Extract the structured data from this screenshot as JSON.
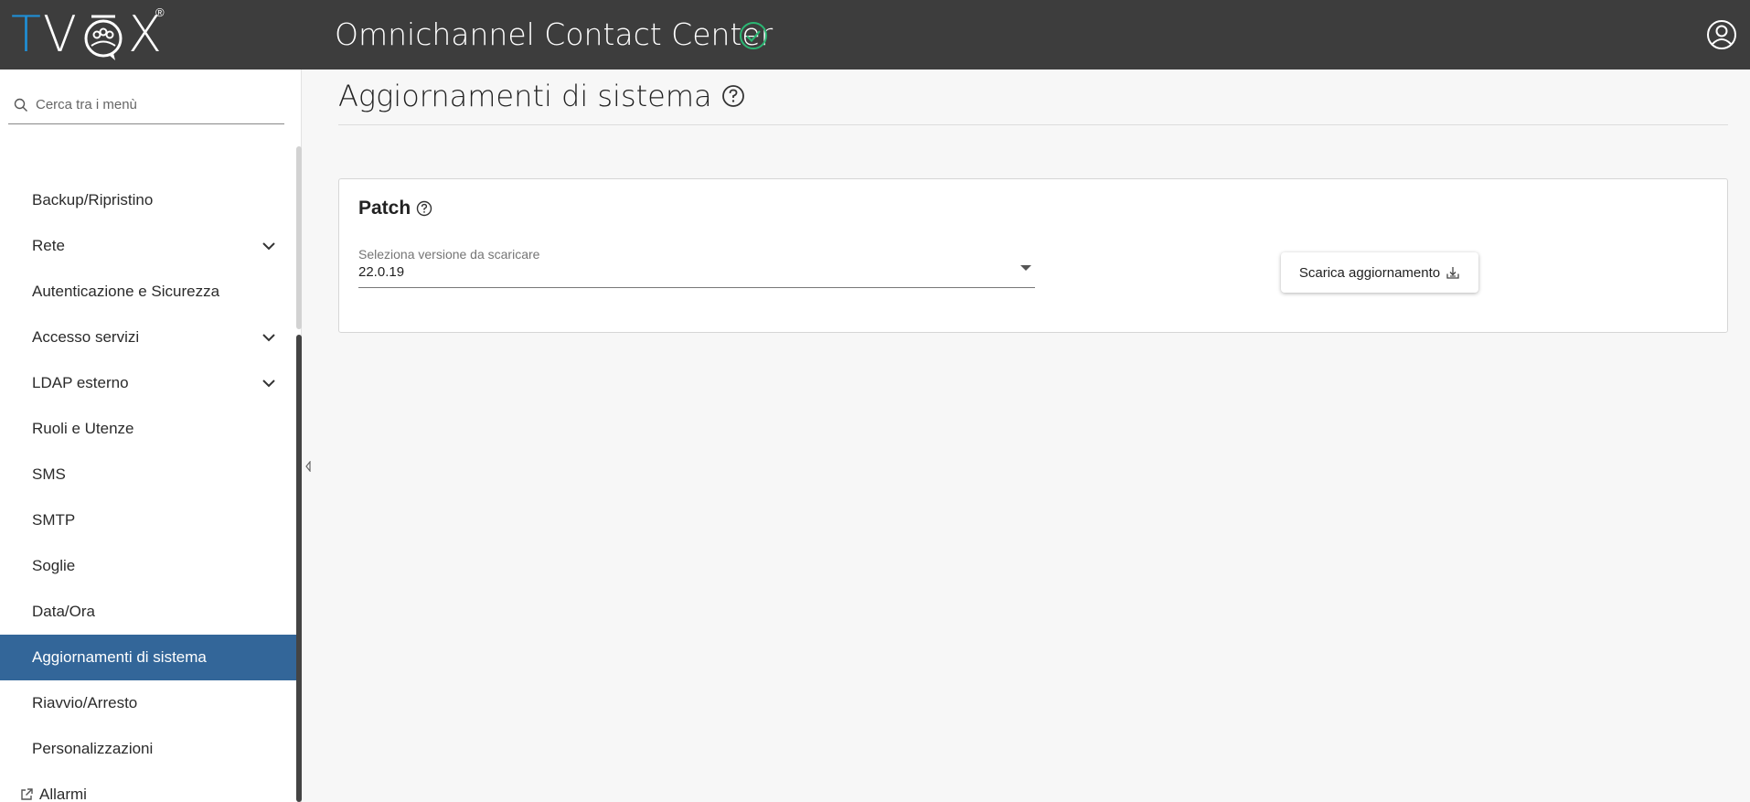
{
  "header": {
    "logo": "TVOX",
    "logo_reg": "®",
    "title": "Omnichannel Contact Center",
    "status_icon": "check-circle-icon",
    "user_icon": "user-circle-icon"
  },
  "sidebar": {
    "search_placeholder": "Cerca tra i menù",
    "items": [
      {
        "label": "Backup/Ripristino",
        "expandable": false,
        "active": false
      },
      {
        "label": "Rete",
        "expandable": true,
        "active": false
      },
      {
        "label": "Autenticazione e Sicurezza",
        "expandable": false,
        "active": false
      },
      {
        "label": "Accesso servizi",
        "expandable": true,
        "active": false
      },
      {
        "label": "LDAP esterno",
        "expandable": true,
        "active": false
      },
      {
        "label": "Ruoli e Utenze",
        "expandable": false,
        "active": false
      },
      {
        "label": "SMS",
        "expandable": false,
        "active": false
      },
      {
        "label": "SMTP",
        "expandable": false,
        "active": false
      },
      {
        "label": "Soglie",
        "expandable": false,
        "active": false
      },
      {
        "label": "Data/Ora",
        "expandable": false,
        "active": false
      },
      {
        "label": "Aggiornamenti di sistema",
        "expandable": false,
        "active": true
      },
      {
        "label": "Riavvio/Arresto",
        "expandable": false,
        "active": false
      },
      {
        "label": "Personalizzazioni",
        "expandable": false,
        "active": false
      },
      {
        "label": "Allarmi",
        "expandable": false,
        "active": false,
        "external": true
      }
    ]
  },
  "main": {
    "title": "Aggiornamenti di sistema",
    "patch_card": {
      "title": "Patch",
      "select_label": "Seleziona versione da scaricare",
      "select_value": "22.0.19",
      "download_button": "Scarica aggiornamento"
    }
  },
  "colors": {
    "header_bg": "#3d3d3d",
    "accent": "#336699",
    "logo_blue": "#1f8fd6",
    "status_green": "#2bb673"
  }
}
